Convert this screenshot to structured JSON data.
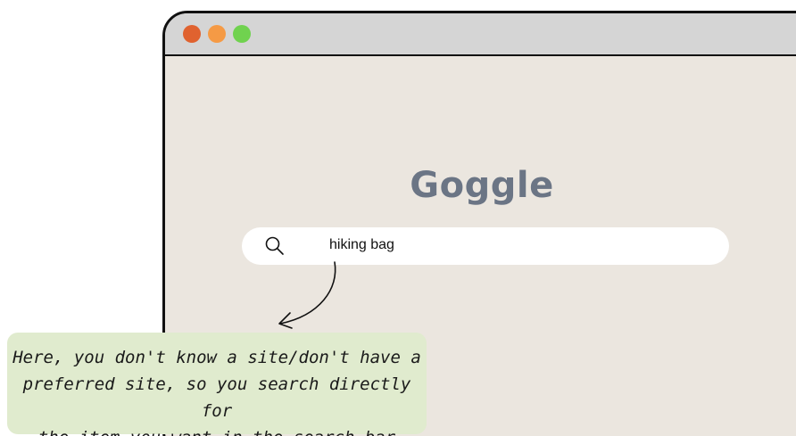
{
  "window": {
    "controls": [
      {
        "name": "close",
        "color": "#e0622f"
      },
      {
        "name": "minimize",
        "color": "#f59a45"
      },
      {
        "name": "maximize",
        "color": "#70d24f"
      }
    ]
  },
  "page": {
    "logo_text": "Goggle"
  },
  "search": {
    "icon": "search-icon",
    "value": "hiking bag"
  },
  "annotation": {
    "arrow_icon": "curved-arrow-icon",
    "callout_lines": [
      "Here, you don't know a site/don't have a",
      "preferred site, so you search directly for",
      "the item you want in the search bar"
    ]
  }
}
